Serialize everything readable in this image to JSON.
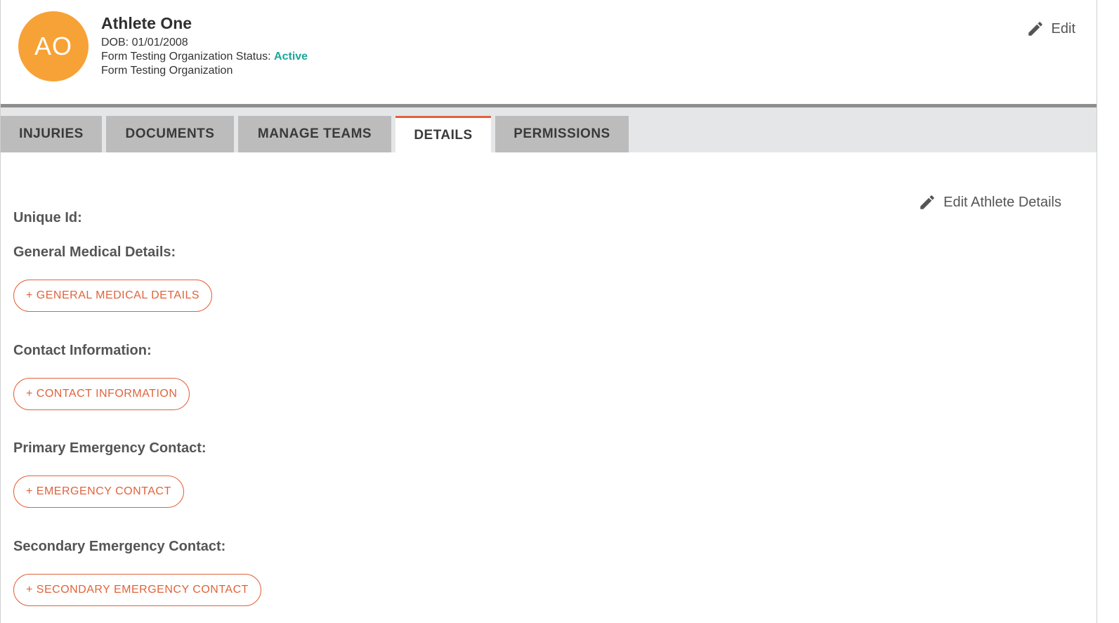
{
  "athlete": {
    "initials": "AO",
    "name": "Athlete One",
    "dob": "DOB: 01/01/2008",
    "status_prefix": "Form Testing Organization Status: ",
    "status_value": "Active",
    "organization": "Form Testing Organization",
    "edit_label": "Edit"
  },
  "colors": {
    "avatar": "#f7a236",
    "status_active": "#1aa89a",
    "accent": "#e0633b"
  },
  "tabs": [
    {
      "label": "INJURIES",
      "active": false
    },
    {
      "label": "DOCUMENTS",
      "active": false
    },
    {
      "label": "MANAGE TEAMS",
      "active": false
    },
    {
      "label": "DETAILS",
      "active": true
    },
    {
      "label": "PERMISSIONS",
      "active": false
    }
  ],
  "details": {
    "edit_label": "Edit Athlete Details",
    "unique_id_label": "Unique Id:",
    "general_medical_label": "General Medical Details:",
    "general_medical_button": "+ GENERAL MEDICAL DETAILS",
    "contact_label": "Contact Information:",
    "contact_button": "+ CONTACT INFORMATION",
    "primary_emergency_label": "Primary Emergency Contact:",
    "primary_emergency_button": "+ EMERGENCY CONTACT",
    "secondary_emergency_label": "Secondary Emergency Contact:",
    "secondary_emergency_button": "+ SECONDARY EMERGENCY CONTACT"
  }
}
